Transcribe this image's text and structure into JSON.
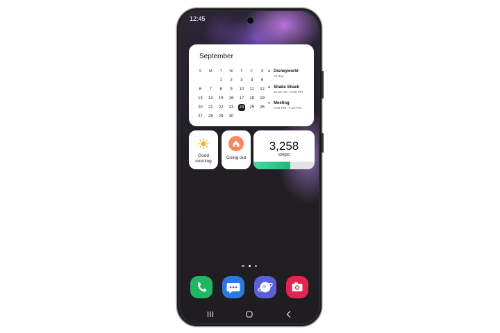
{
  "status_bar": {
    "time": "12:45"
  },
  "calendar": {
    "month": "September",
    "weekdays": [
      "S",
      "M",
      "T",
      "W",
      "T",
      "F",
      "S"
    ],
    "days": [
      "",
      "",
      "1",
      "2",
      "3",
      "4",
      "5",
      "6",
      "7",
      "8",
      "9",
      "10",
      "11",
      "12",
      "13",
      "14",
      "15",
      "16",
      "17",
      "18",
      "19",
      "20",
      "21",
      "22",
      "23",
      "24",
      "25",
      "26",
      "27",
      "28",
      "29",
      "30",
      "",
      "",
      ""
    ],
    "today": "24",
    "events": [
      {
        "title": "Disneyworld",
        "time": "All day",
        "color": "#6a8fd8"
      },
      {
        "title": "Shake Shack",
        "time": "11:00 AM - 2:00 PM",
        "color": "#e0634a"
      },
      {
        "title": "Meeting",
        "time": "3:00 PM - 4:30 PM",
        "color": "#8bbd3a"
      }
    ]
  },
  "weather_tile": {
    "label_line1": "Good",
    "label_line2": "morning",
    "icon": "sun-icon",
    "icon_color": "#f6b422"
  },
  "mode_tile": {
    "label": "Going out",
    "icon": "home-icon",
    "icon_color": "#f38a5e"
  },
  "steps_tile": {
    "count": "3,258",
    "unit": "steps",
    "progress": 0.6,
    "bar_color": "#1fb876"
  },
  "dock": [
    {
      "name": "phone-app-icon",
      "color": "#1fb764"
    },
    {
      "name": "messages-app-icon",
      "color": "#2a79e0"
    },
    {
      "name": "internet-app-icon",
      "color": "#5b5fd8"
    },
    {
      "name": "camera-app-icon",
      "color": "#e0264f"
    }
  ],
  "nav": {
    "buttons": [
      "recents-button",
      "home-button",
      "back-button"
    ]
  }
}
